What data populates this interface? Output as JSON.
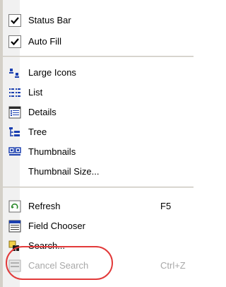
{
  "menu": {
    "items": [
      {
        "key": "status_bar",
        "label": "Status Bar",
        "checked": true
      },
      {
        "key": "auto_fill",
        "label": "Auto Fill",
        "checked": true
      },
      {
        "key": "large_icons",
        "label": "Large Icons",
        "icon": "large-icons-icon"
      },
      {
        "key": "list",
        "label": "List",
        "icon": "list-view-icon"
      },
      {
        "key": "details",
        "label": "Details",
        "icon": "details-view-icon"
      },
      {
        "key": "tree",
        "label": "Tree",
        "icon": "tree-view-icon"
      },
      {
        "key": "thumbnails",
        "label": "Thumbnails",
        "icon": "thumbnails-icon"
      },
      {
        "key": "thumbnail_size",
        "label": "Thumbnail Size..."
      },
      {
        "key": "refresh",
        "label": "Refresh",
        "shortcut": "F5",
        "icon": "refresh-icon"
      },
      {
        "key": "field_chooser",
        "label": "Field Chooser",
        "icon": "field-chooser-icon"
      },
      {
        "key": "search",
        "label": "Search...",
        "icon": "search-binoculars-icon"
      },
      {
        "key": "cancel_search",
        "label": "Cancel Search",
        "shortcut": "Ctrl+Z",
        "disabled": true,
        "icon": "cancel-search-icon"
      }
    ]
  },
  "annotation": {
    "color": "#e23a3a",
    "shape": "highlight-circle"
  }
}
